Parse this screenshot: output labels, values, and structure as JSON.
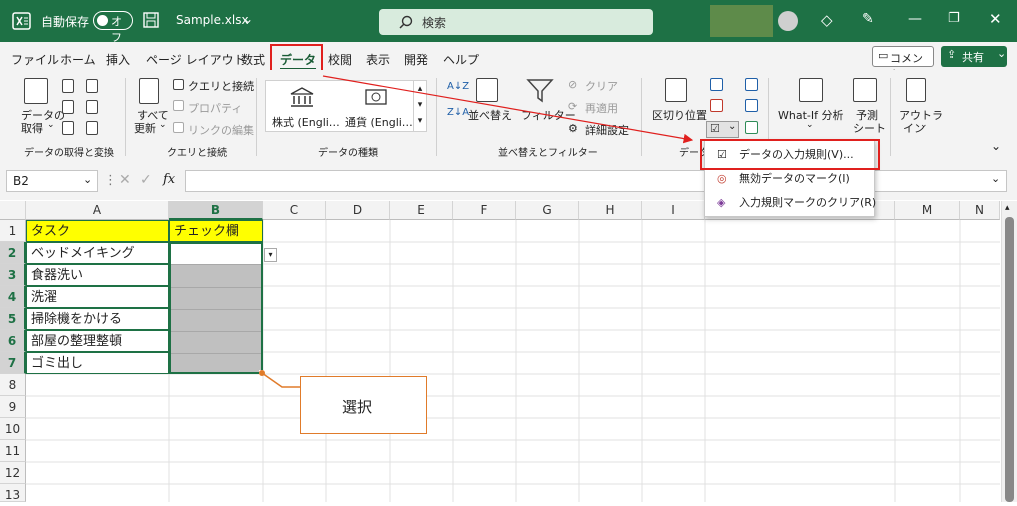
{
  "titlebar": {
    "autosave_label": "自動保存",
    "autosave_state": "オフ",
    "filename": "Sample.xlsx",
    "search_placeholder": "検索"
  },
  "menu": {
    "file": "ファイル",
    "home": "ホーム",
    "insert": "挿入",
    "page_layout": "ページ レイアウト",
    "formulas": "数式",
    "data": "データ",
    "review": "校閲",
    "view": "表示",
    "developer": "開発",
    "help": "ヘルプ",
    "comments": "コメント",
    "share": "共有"
  },
  "ribbon": {
    "get_data_1": "データの",
    "get_data_2": "取得",
    "get_transform_group": "データの取得と変換",
    "refresh_all_1": "すべて",
    "refresh_all_2": "更新",
    "queries_connections": "クエリと接続",
    "properties": "プロパティ",
    "edit_links": "リンクの編集",
    "queries_group": "クエリと接続",
    "stocks": "株式 (Engli…",
    "currencies": "通貨 (Engli…",
    "data_types_group": "データの種類",
    "sort": "並べ替え",
    "filter": "フィルター",
    "clear": "クリア",
    "reapply": "再適用",
    "advanced": "詳細設定",
    "sort_filter_group": "並べ替えとフィルター",
    "text_to_columns": "区切り位置",
    "data_tools_group": "データ",
    "whatif": "What-If 分析",
    "forecast_1": "予測",
    "forecast_2": "シート",
    "outline_1": "アウトラ",
    "outline_2": "イン"
  },
  "dropdown": {
    "items": [
      "データの入力規則(V)...",
      "無効データのマーク(I)",
      "入力規則マークのクリア(R)"
    ]
  },
  "formula_bar": {
    "name_box": "B2",
    "fx": "fx",
    "content": ""
  },
  "columns": [
    "A",
    "B",
    "C",
    "D",
    "E",
    "F",
    "G",
    "H",
    "I",
    "L",
    "M",
    "N"
  ],
  "rows": [
    "1",
    "2",
    "3",
    "4",
    "5",
    "6",
    "7",
    "8",
    "9",
    "10",
    "11",
    "12",
    "13"
  ],
  "sheet": {
    "A1": "タスク",
    "B1": "チェック欄",
    "A2": "ベッドメイキング",
    "A3": "食器洗い",
    "A4": "洗濯",
    "A5": "掃除機をかける",
    "A6": "部屋の整理整頓",
    "A7": "ゴミ出し"
  },
  "callout": {
    "text": "選択"
  },
  "colors": {
    "excel_green": "#1e7145",
    "header_yellow": "#ffff00",
    "selected_gray": "#c0c0c0",
    "highlight_red": "#e0201e",
    "callout_orange": "#e07b2a"
  }
}
